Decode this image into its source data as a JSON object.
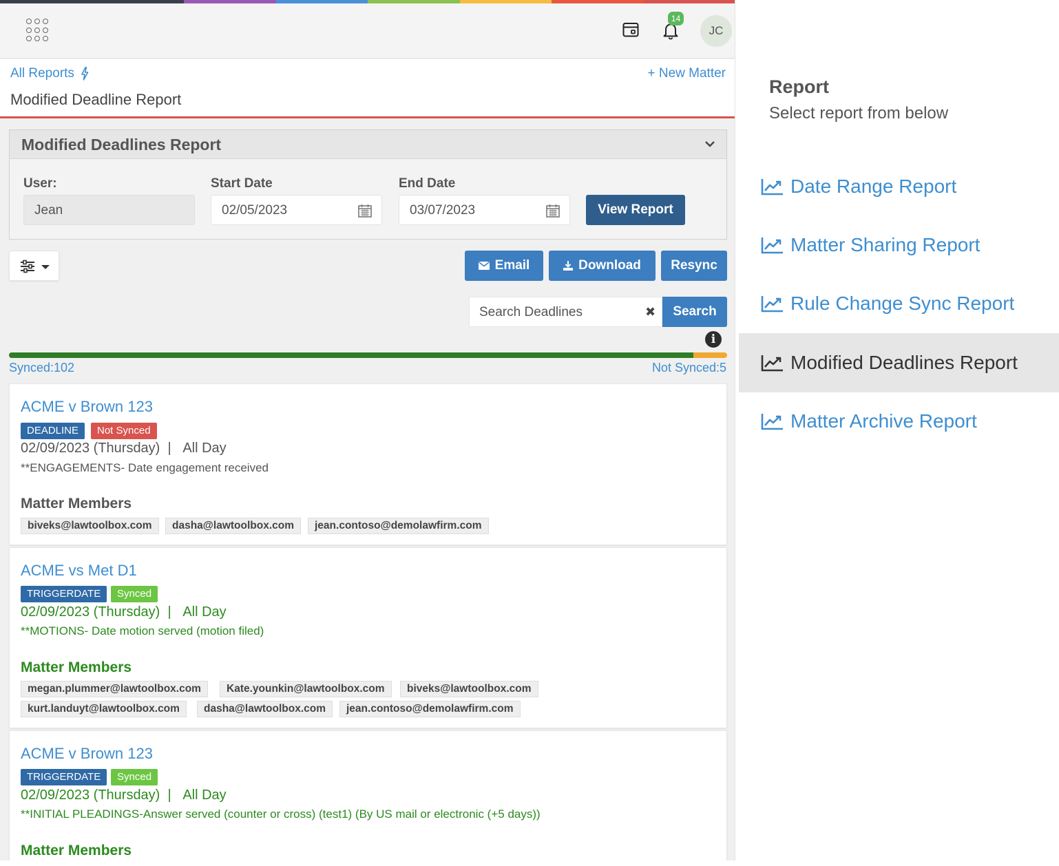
{
  "topbar": {
    "strip_colors": [
      "#3a3f4b",
      "#3a3f4b",
      "#9b59b6",
      "#4a90d9",
      "#8cc152",
      "#f6bb42",
      "#e9573f",
      "#d9534f"
    ],
    "notification_count": "14",
    "avatar_initials": "JC"
  },
  "header": {
    "all_reports": "All Reports",
    "new_matter": "+ New Matter",
    "page_title": "Modified Deadline Report"
  },
  "panel": {
    "title": "Modified Deadlines Report",
    "user_label": "User:",
    "user_value": "Jean",
    "start_label": "Start Date",
    "start_value": "02/05/2023",
    "end_label": "End Date",
    "end_value": "03/07/2023",
    "view_button": "View Report"
  },
  "actions": {
    "email": "Email",
    "download": "Download",
    "resync": "Resync"
  },
  "search": {
    "placeholder": "Search Deadlines",
    "button": "Search"
  },
  "sync": {
    "synced_label": "Synced:102",
    "not_synced_label": "Not Synced:5",
    "synced": 102,
    "not_synced": 5,
    "colors": {
      "synced": "#2f7d28",
      "not_synced": "#f0a830"
    }
  },
  "cards": [
    {
      "title": "ACME v Brown 123",
      "type": "DEADLINE",
      "status": "Not Synced",
      "date": "02/09/2023 (Thursday)",
      "time": "All Day",
      "description": "**ENGAGEMENTS- Date engagement received",
      "members_label": "Matter Members",
      "members": [
        "biveks@lawtoolbox.com",
        "dasha@lawtoolbox.com",
        "jean.contoso@demolawfirm.com"
      ]
    },
    {
      "title": "ACME vs Met D1",
      "type": "TRIGGERDATE",
      "status": "Synced",
      "date": "02/09/2023 (Thursday)",
      "time": "All Day",
      "description": "**MOTIONS- Date motion served (motion filed)",
      "members_label": "Matter Members",
      "members": [
        "megan.plummer@lawtoolbox.com",
        "Kate.younkin@lawtoolbox.com",
        "biveks@lawtoolbox.com",
        "kurt.landuyt@lawtoolbox.com",
        "dasha@lawtoolbox.com",
        "jean.contoso@demolawfirm.com"
      ]
    },
    {
      "title": "ACME v Brown 123",
      "type": "TRIGGERDATE",
      "status": "Synced",
      "date": "02/09/2023 (Thursday)",
      "time": "All Day",
      "description": "**INITIAL PLEADINGS-Answer served (counter or cross) (test1) (By US mail or electronic (+5 days))",
      "members_label": "Matter Members"
    }
  ],
  "side": {
    "title": "Report",
    "subtitle": "Select report from below",
    "items": [
      {
        "label": "Date Range Report",
        "icon": "line-chart-icon",
        "active": false
      },
      {
        "label": "Matter Sharing Report",
        "icon": "line-chart-icon",
        "active": false
      },
      {
        "label": "Rule Change Sync Report",
        "icon": "line-chart-icon",
        "active": false
      },
      {
        "label": "Modified Deadlines Report",
        "icon": "line-chart-icon",
        "active": true
      },
      {
        "label": "Matter Archive Report",
        "icon": "line-chart-icon",
        "active": false
      }
    ]
  }
}
